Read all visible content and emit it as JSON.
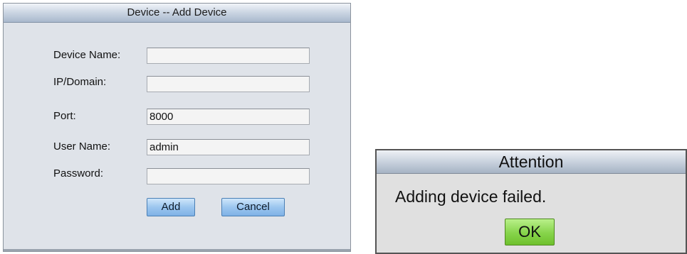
{
  "add_device_dialog": {
    "title": "Device -- Add Device",
    "fields": [
      {
        "label": "Device Name:",
        "value": ""
      },
      {
        "label": "IP/Domain:",
        "value": ""
      },
      {
        "label": "Port:",
        "value": "8000"
      },
      {
        "label": "User Name:",
        "value": "admin"
      },
      {
        "label": "Password:",
        "value": ""
      }
    ],
    "add_label": "Add",
    "cancel_label": "Cancel"
  },
  "attention_dialog": {
    "title": "Attention",
    "message": "Adding device failed.",
    "ok_label": "OK"
  }
}
